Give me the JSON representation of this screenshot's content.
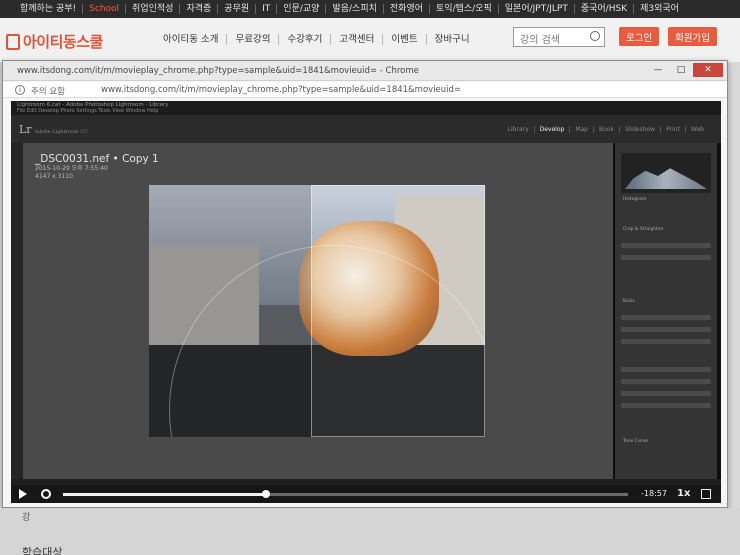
{
  "topbar": {
    "items": [
      "함께하는 공부!",
      "취업인적성",
      "자격증",
      "공무원",
      "IT",
      "인문/교양",
      "발음/스피치",
      "전화영어",
      "토익/텝스/오픽",
      "일본어/JPT/JLPT",
      "중국어/HSK",
      "제3외국어"
    ],
    "school_label": "School"
  },
  "header": {
    "logo_text": "아이티동스쿨",
    "nav": [
      "아이티동 소개",
      "무료강의",
      "수강후기",
      "고객센터",
      "이벤트",
      "장바구니"
    ],
    "search_placeholder": "강의 검색",
    "login_label": "로그인",
    "join_label": "회원가입",
    "accent_color": "#e65c3e"
  },
  "popup": {
    "title": "www.itsdong.com/it/m/movieplay_chrome.php?type=sample&uid=1841&movieuid= - Chrome",
    "warning": "주의 요함",
    "url": "www.itsdong.com/it/m/movieplay_chrome.php?type=sample&uid=1841&movieuid="
  },
  "lightroom": {
    "window_title": "Lightroom 6.cat - Adobe Photoshop Lightroom - Library",
    "menu": "File  Edit  Develop  Photo  Settings  Tools  View  Window  Help",
    "logo": "Lr",
    "logo_sub": "Adobe Lightroom CC",
    "modules": [
      "Library",
      "Develop",
      "Map",
      "Book",
      "Slideshow",
      "Print",
      "Web"
    ],
    "active_module": "Develop",
    "file_name": "_DSC0031.nef • Copy 1",
    "file_date": "2015-10-29 오후 7:55:40",
    "file_dims": "4147 x 3110",
    "panel_labels": [
      "Histogram",
      "Crop & Straighten",
      "Basic",
      "Tone Curve"
    ]
  },
  "player": {
    "time": "-18:57",
    "speed": "1x",
    "progress": 0.36
  },
  "below": {
    "line1": "강",
    "line2": "학습대상"
  }
}
